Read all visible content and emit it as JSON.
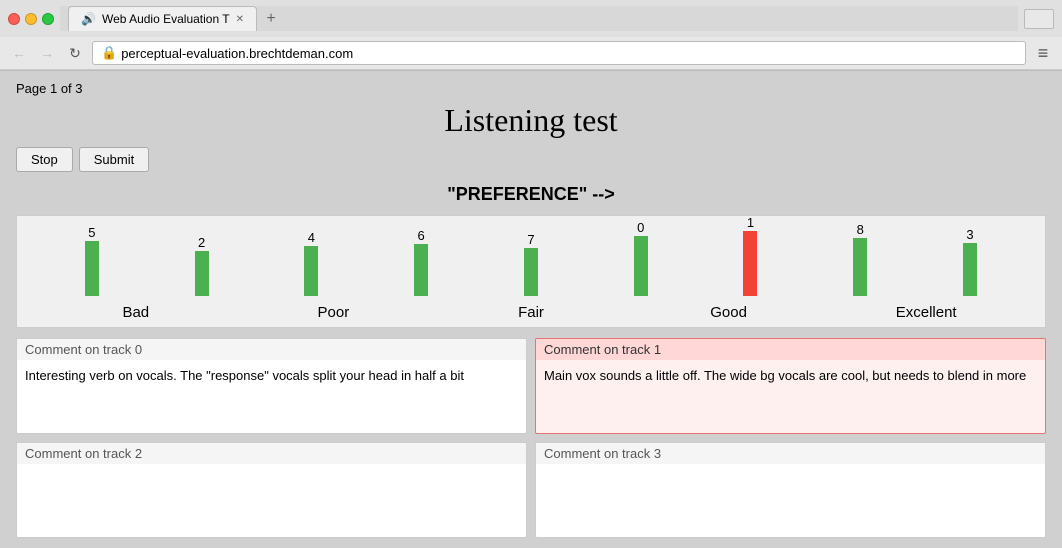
{
  "browser": {
    "tab_title": "Web Audio Evaluation T",
    "url": "perceptual-evaluation.brechtdeman.com",
    "menu_icon": "≡"
  },
  "page": {
    "page_info": "Page 1 of 3",
    "title": "Listening test",
    "stop_label": "Stop",
    "submit_label": "Submit",
    "question_label": "\"PREFERENCE\" -->"
  },
  "tracks": [
    {
      "id": "5",
      "height": 55,
      "color": "green"
    },
    {
      "id": "2",
      "height": 45,
      "color": "green"
    },
    {
      "id": "4",
      "height": 50,
      "color": "green"
    },
    {
      "id": "6",
      "height": 52,
      "color": "green"
    },
    {
      "id": "7",
      "height": 48,
      "color": "green"
    },
    {
      "id": "0",
      "height": 60,
      "color": "green"
    },
    {
      "id": "1",
      "height": 65,
      "color": "red"
    },
    {
      "id": "8",
      "height": 58,
      "color": "green"
    },
    {
      "id": "3",
      "height": 53,
      "color": "green"
    }
  ],
  "slider_labels": [
    "Bad",
    "Poor",
    "Fair",
    "Good",
    "Excellent"
  ],
  "comments": [
    {
      "id": 0,
      "header": "Comment on track 0",
      "header_style": "default",
      "box_style": "default",
      "text": "Interesting verb on vocals. The \"response\" vocals split your head in half a bit",
      "editable": true
    },
    {
      "id": 1,
      "header": "Comment on track 1",
      "header_style": "red",
      "box_style": "red",
      "text": "Main vox sounds a little off. The wide bg vocals are cool, but needs to blend in more",
      "editable": true
    },
    {
      "id": 2,
      "header": "Comment on track 2",
      "header_style": "default",
      "box_style": "default",
      "text": "",
      "editable": true
    },
    {
      "id": 3,
      "header": "Comment on track 3",
      "header_style": "default",
      "box_style": "default",
      "text": "",
      "editable": true
    }
  ]
}
